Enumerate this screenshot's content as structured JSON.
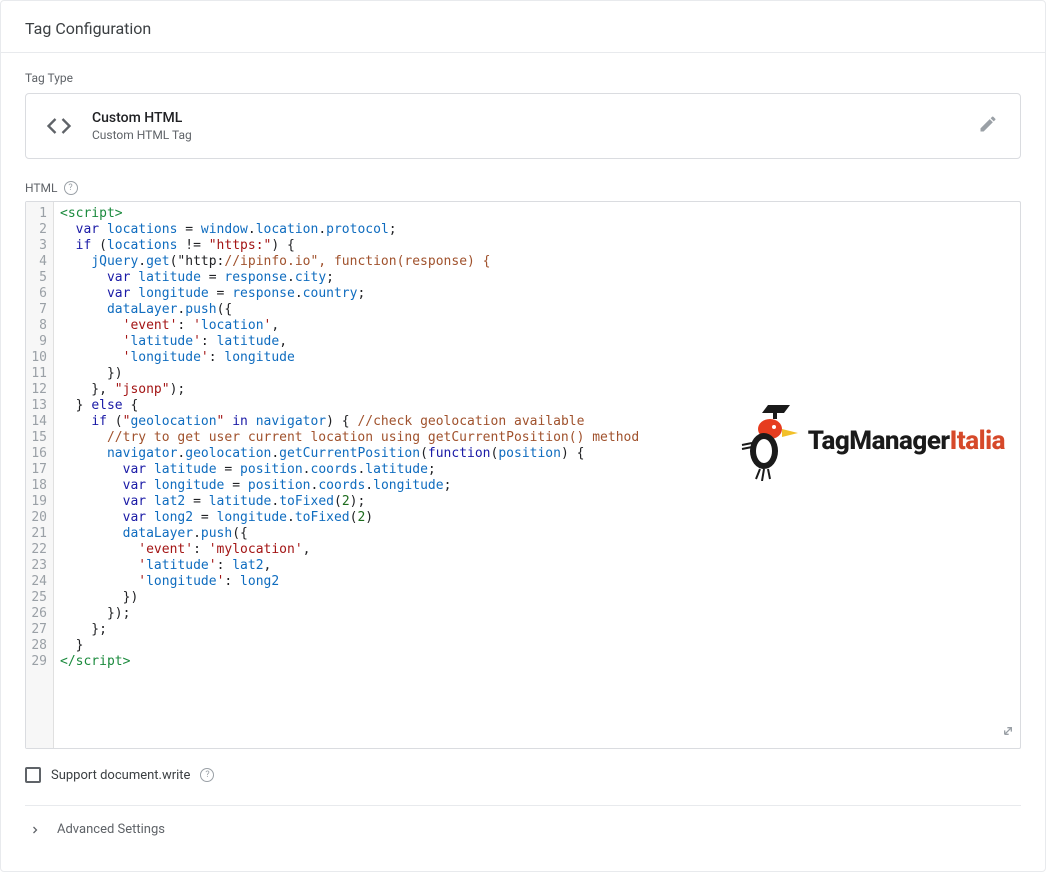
{
  "header": {
    "title": "Tag Configuration"
  },
  "tagType": {
    "label": "Tag Type",
    "title": "Custom HTML",
    "subtitle": "Custom HTML Tag"
  },
  "htmlSection": {
    "label": "HTML"
  },
  "code": {
    "lineCount": 29,
    "lines": [
      "<script>",
      "  var locations = window.location.protocol;",
      "  if (locations != \"https:\") {",
      "    jQuery.get(\"http://ipinfo.io\", function(response) {",
      "      var latitude = response.city;",
      "      var longitude = response.country;",
      "      dataLayer.push({",
      "        'event': 'location',",
      "        'latitude': latitude,",
      "        'longitude': longitude",
      "      })",
      "    }, \"jsonp\");",
      "  } else {",
      "    if (\"geolocation\" in navigator) { //check geolocation available ",
      "      //try to get user current location using getCurrentPosition() method",
      "      navigator.geolocation.getCurrentPosition(function(position) {",
      "        var latitude = position.coords.latitude;",
      "        var longitude = position.coords.longitude;",
      "        var lat2 = latitude.toFixed(2);",
      "        var long2 = longitude.toFixed(2)",
      "        dataLayer.push({",
      "          'event': 'mylocation',",
      "          'latitude': lat2,",
      "          'longitude': long2",
      "        })",
      "      });",
      "    };",
      "  }",
      "</script>"
    ]
  },
  "supportDocWrite": {
    "label": "Support document.write",
    "checked": false
  },
  "advanced": {
    "label": "Advanced Settings",
    "expanded": false
  },
  "watermark": {
    "brandA": "TagManager",
    "brandB": "Italia"
  }
}
